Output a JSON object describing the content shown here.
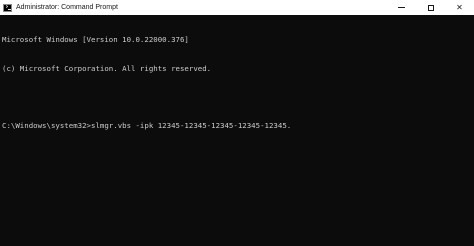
{
  "window": {
    "title": "Administrator: Command Prompt",
    "icon": "cmd-icon",
    "controls": {
      "minimize": "minimize-icon",
      "maximize": "maximize-icon",
      "close_glyph": "✕"
    }
  },
  "console": {
    "lines": [
      "Microsoft Windows [Version 10.0.22000.376]",
      "(c) Microsoft Corporation. All rights reserved.",
      "",
      "C:\\Windows\\system32>slmgr.vbs -ipk 12345-12345-12345-12345-12345."
    ]
  },
  "colors": {
    "console_bg": "#0c0c0c",
    "console_text": "#cccccc",
    "titlebar_bg": "#ffffff"
  }
}
